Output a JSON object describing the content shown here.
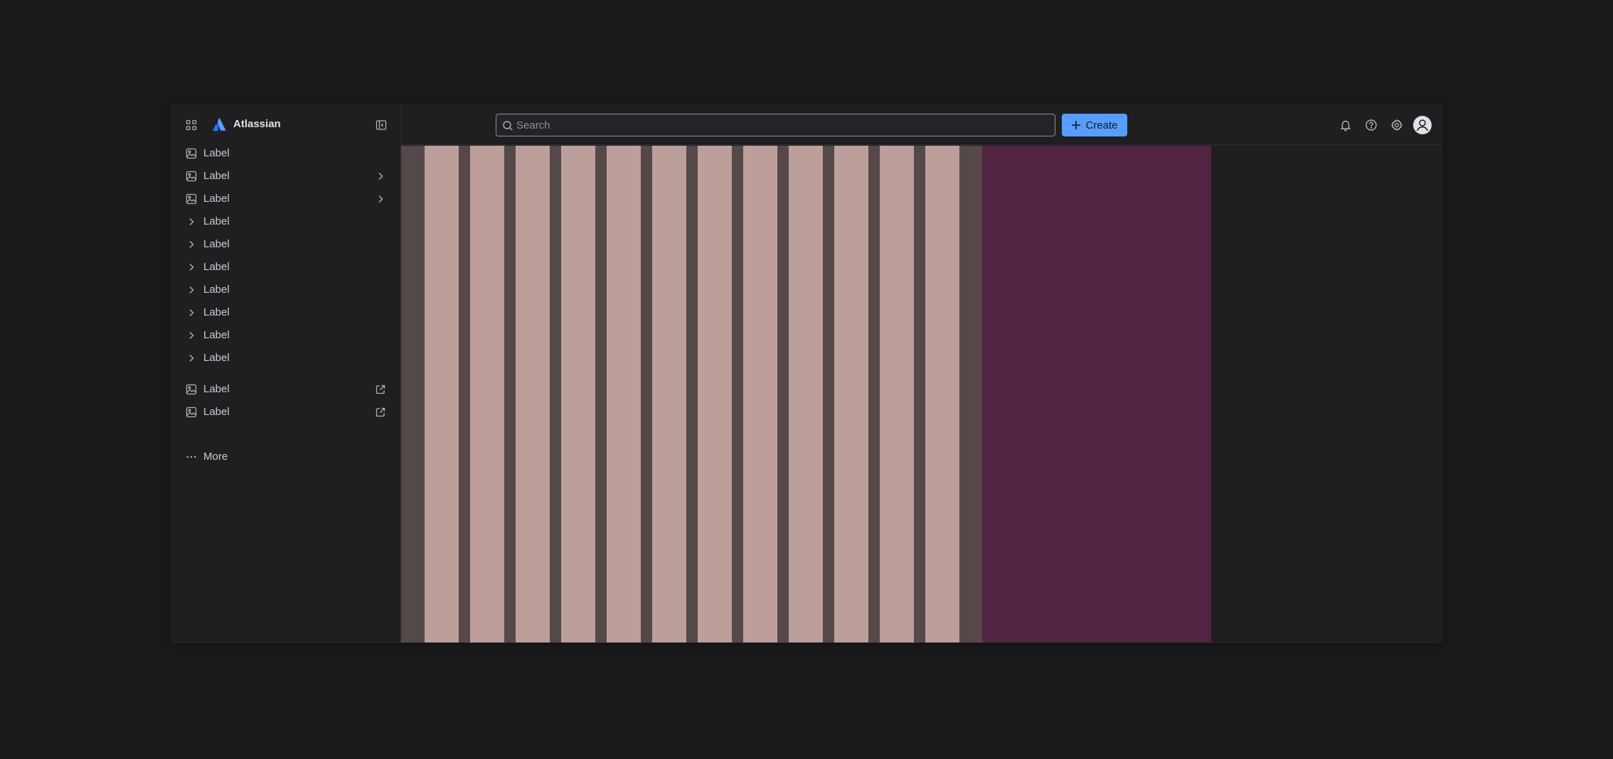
{
  "brand": {
    "name": "Atlassian"
  },
  "sidebar": {
    "items": [
      {
        "label": "Label",
        "lead_icon": "image-icon",
        "trail_icon": ""
      },
      {
        "label": "Label",
        "lead_icon": "image-icon",
        "trail_icon": "chevron-right-icon"
      },
      {
        "label": "Label",
        "lead_icon": "image-icon",
        "trail_icon": "chevron-right-icon"
      },
      {
        "label": "Label",
        "lead_icon": "chevron-right-icon",
        "trail_icon": ""
      },
      {
        "label": "Label",
        "lead_icon": "chevron-right-icon",
        "trail_icon": ""
      },
      {
        "label": "Label",
        "lead_icon": "chevron-right-icon",
        "trail_icon": ""
      },
      {
        "label": "Label",
        "lead_icon": "chevron-right-icon",
        "trail_icon": ""
      },
      {
        "label": "Label",
        "lead_icon": "chevron-right-icon",
        "trail_icon": ""
      },
      {
        "label": "Label",
        "lead_icon": "chevron-right-icon",
        "trail_icon": ""
      },
      {
        "label": "Label",
        "lead_icon": "chevron-right-icon",
        "trail_icon": ""
      },
      {
        "label": "Label",
        "lead_icon": "image-icon",
        "trail_icon": "external-link-icon"
      },
      {
        "label": "Label",
        "lead_icon": "image-icon",
        "trail_icon": "external-link-icon"
      }
    ],
    "more_label": "More"
  },
  "topbar": {
    "search_placeholder": "Search",
    "create_label": "Create",
    "icons": [
      "notification-bell-icon",
      "help-icon",
      "settings-gear-icon",
      "avatar-icon"
    ]
  },
  "content": {
    "column_count": 12
  },
  "colors": {
    "page_bg": "#18191b",
    "surface": "#1f1f21",
    "accent": "#579dff",
    "grid_gutter": "#554848",
    "grid_column": "#bc9e9b",
    "aside_panel": "#512541"
  }
}
